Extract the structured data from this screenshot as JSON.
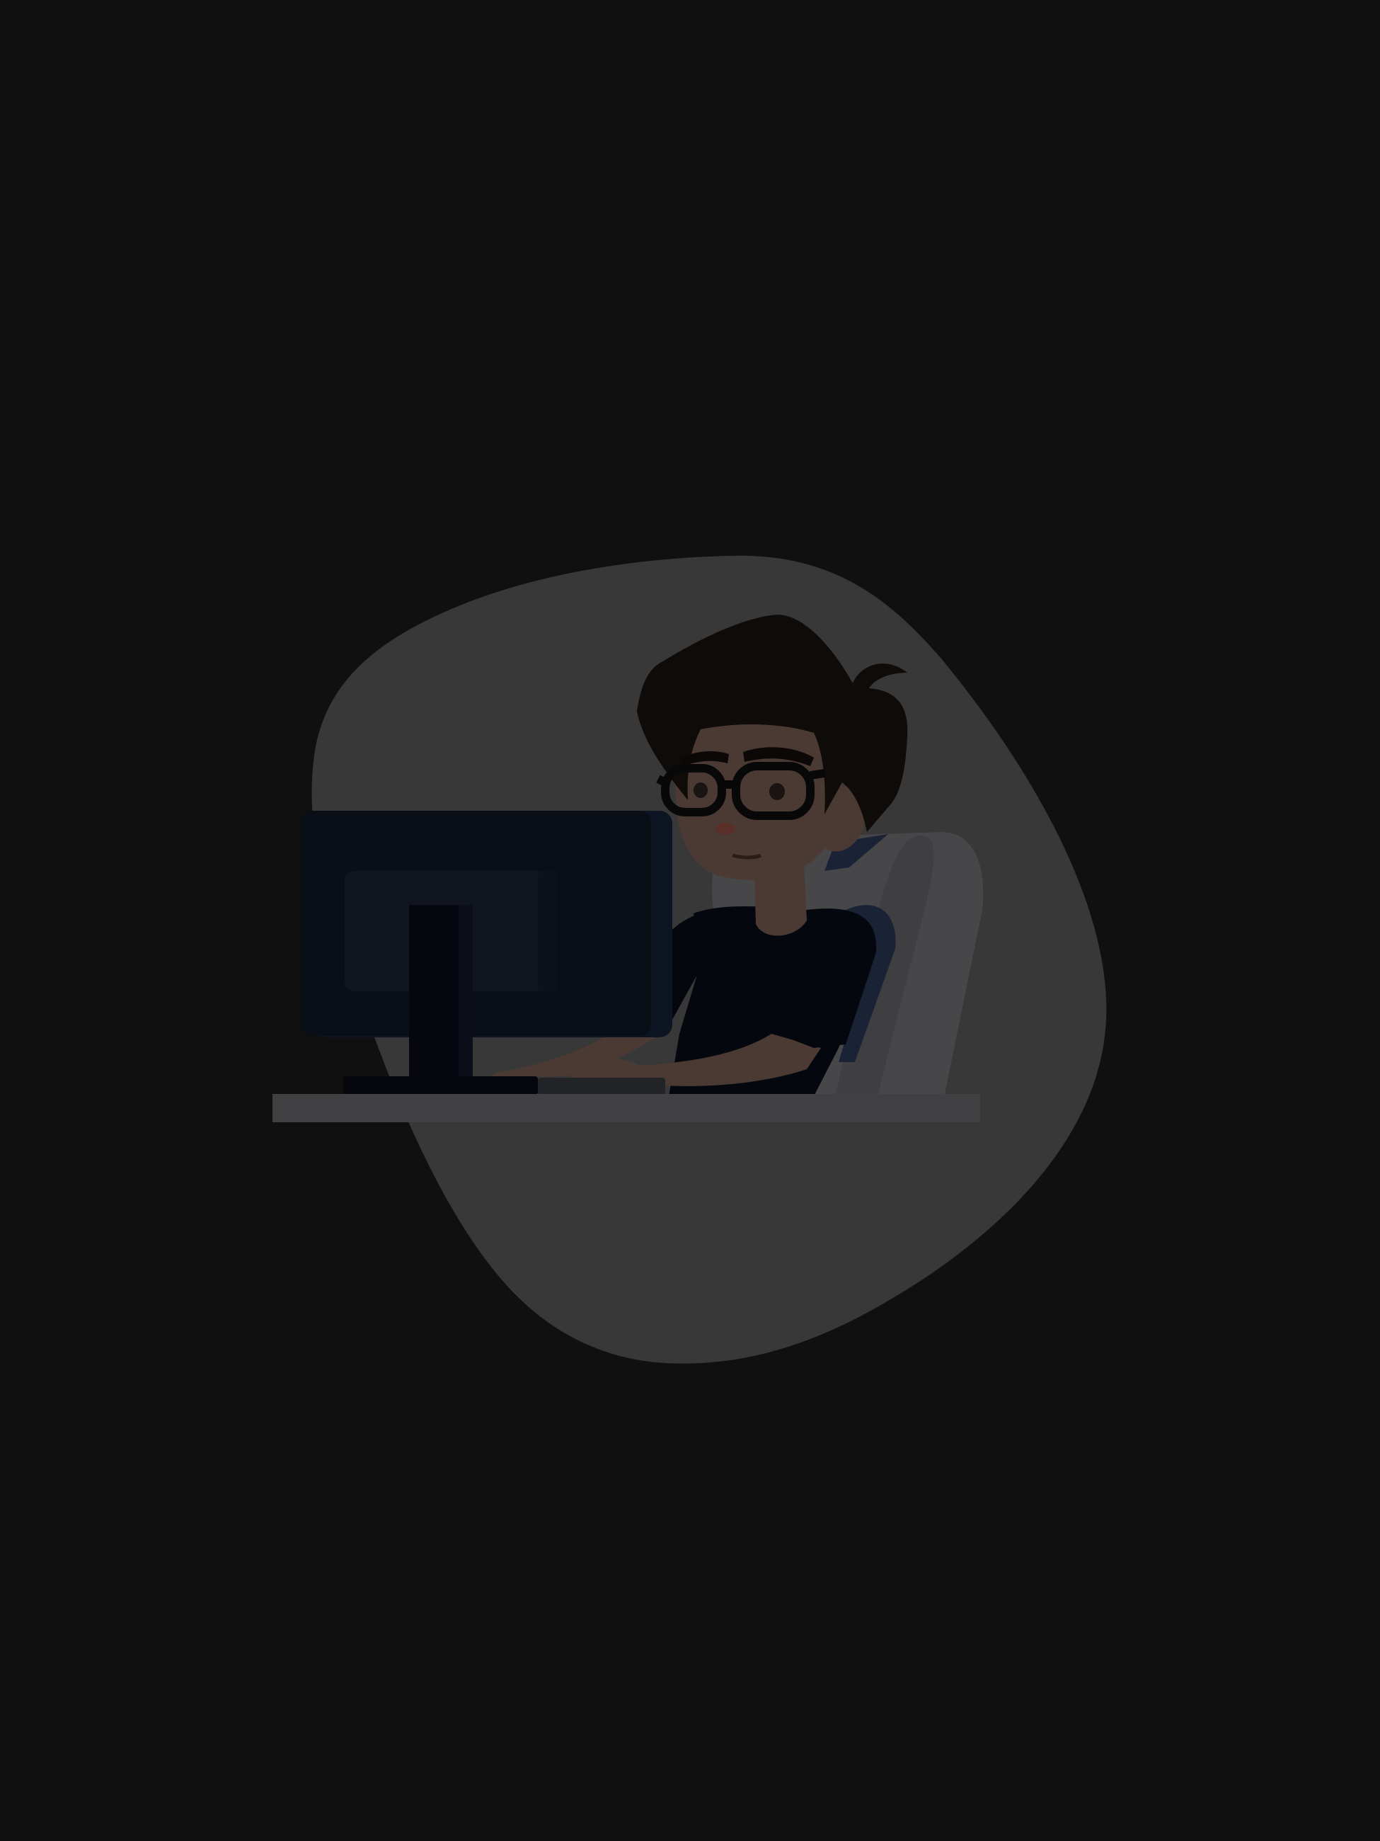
{
  "scene": {
    "background_color": "#101010",
    "blob_color": "#383838",
    "desk_color": "#414143",
    "monitor_color": "#0a0f17",
    "shirt_color": "#05070f",
    "chair_color": "#47474a",
    "chair_trim_color": "#1a2236",
    "skin_color": "#4b3a33",
    "hair_color": "#0f0b09",
    "glasses_color": "#080808"
  }
}
